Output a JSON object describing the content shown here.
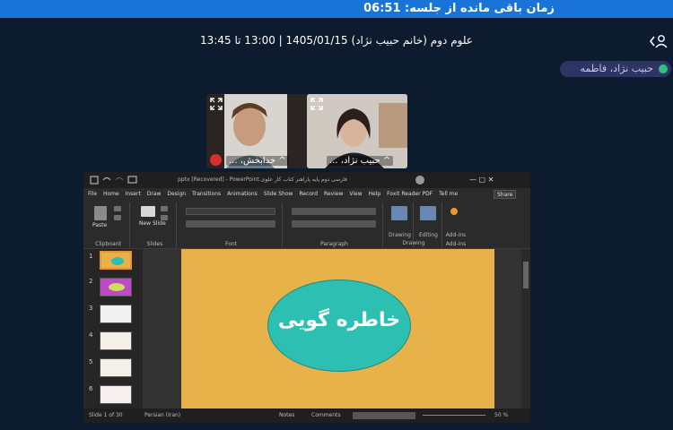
{
  "session": {
    "remaining_label": "زمان باقی مانده از جلسه: 06:51"
  },
  "header": {
    "title": "علوم دوم (خانم حبیب نژاد) 1405/01/15 | 13:00 تا 13:45"
  },
  "participant_chip": {
    "name": "حبیب نژاد، فاطمه"
  },
  "video_tiles": [
    {
      "label": "^ خدابخش، ..."
    },
    {
      "label": "^ حبیب نژاد، ..."
    }
  ],
  "ppt": {
    "title": "فارسی دوم پایه پاراهنر کتاب کار علوی.pptx [Recovered] - PowerPoint",
    "menu": [
      "File",
      "Home",
      "Insert",
      "Draw",
      "Design",
      "Transitions",
      "Animations",
      "Slide Show",
      "Record",
      "Review",
      "View",
      "Help",
      "Foxit Reader PDF",
      "Tell me"
    ],
    "share": "Share",
    "ribbon_groups": [
      "Clipboard",
      "Slides",
      "Font",
      "Paragraph",
      "Drawing",
      "Editing",
      "Add-ins"
    ],
    "ribbon_buttons": {
      "paste": "Paste",
      "new_slide": "New Slide",
      "drawing": "Drawing",
      "editing": "Editing",
      "addins": "Add-ins"
    },
    "slide_numbers": [
      "1",
      "2",
      "3",
      "4",
      "5",
      "6"
    ],
    "slide_text": "خاطره گویی",
    "status": {
      "slide": "Slide 1 of 30",
      "language": "Persian (Iran)",
      "notes": "Notes",
      "comments": "Comments",
      "zoom": "50 %"
    }
  },
  "colors": {
    "topbar": "#1a73d6",
    "background": "#0d1b2e",
    "slide_bg": "#e8b24a",
    "ellipse": "#2dbfb2"
  }
}
